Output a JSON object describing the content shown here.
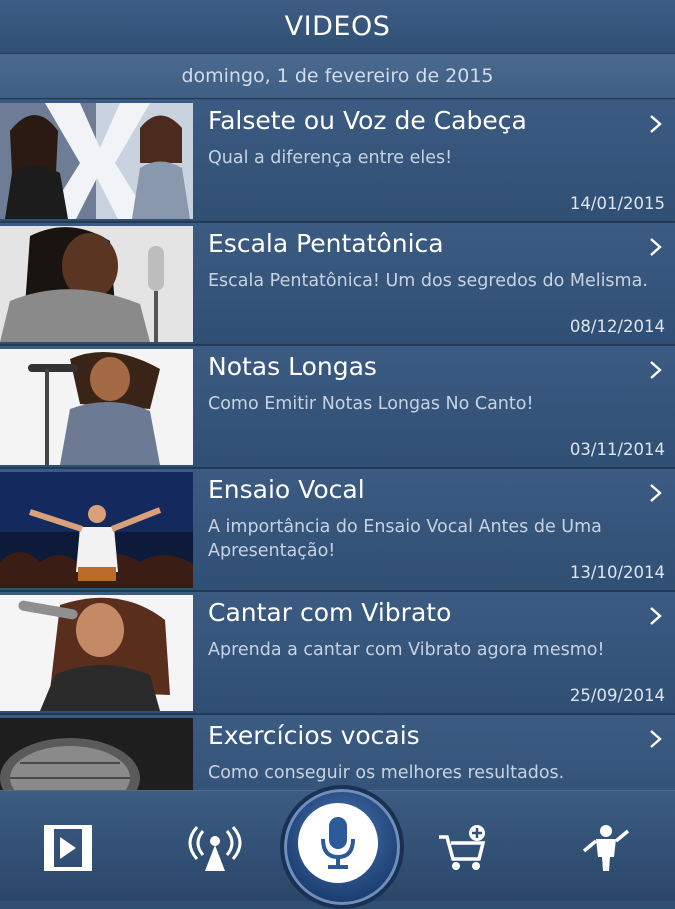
{
  "header": {
    "title": "VIDEOS"
  },
  "date_bar": {
    "text": "domingo, 1 de fevereiro de 2015"
  },
  "videos": [
    {
      "title": "Falsete ou Voz de Cabeça",
      "subtitle": "Qual a diferença entre eles!",
      "date": "14/01/2015"
    },
    {
      "title": "Escala Pentatônica",
      "subtitle": "Escala Pentatônica! Um dos segredos do Melisma.",
      "date": "08/12/2014"
    },
    {
      "title": "Notas Longas",
      "subtitle": "Como Emitir Notas Longas No Canto!",
      "date": "03/11/2014"
    },
    {
      "title": "Ensaio Vocal",
      "subtitle": "A importância do Ensaio Vocal Antes de Uma Apresentação!",
      "date": "13/10/2014"
    },
    {
      "title": "Cantar com Vibrato",
      "subtitle": "Aprenda a cantar com  Vibrato agora mesmo!",
      "date": "25/09/2014"
    },
    {
      "title": "Exercícios vocais",
      "subtitle": "Como conseguir os melhores resultados.",
      "date": ""
    }
  ],
  "tabbar": {
    "items": [
      "videos-icon",
      "broadcast-icon",
      "microphone-icon",
      "cart-add-icon",
      "teacher-icon"
    ]
  },
  "colors": {
    "background": "#35557a",
    "accent": "#2f5fa5",
    "text": "#ffffff"
  }
}
